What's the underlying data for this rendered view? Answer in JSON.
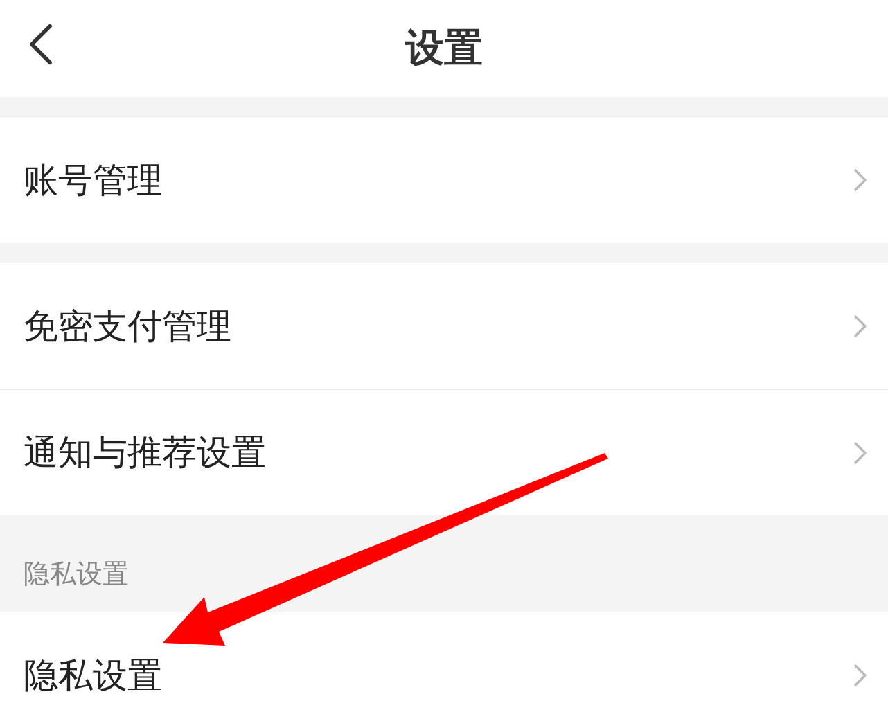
{
  "header": {
    "title": "设置"
  },
  "groups": [
    {
      "items": [
        {
          "label": "账号管理"
        }
      ]
    },
    {
      "items": [
        {
          "label": "免密支付管理"
        },
        {
          "label": "通知与推荐设置"
        }
      ]
    },
    {
      "section": "隐私设置",
      "items": [
        {
          "label": "隐私设置"
        }
      ]
    }
  ]
}
